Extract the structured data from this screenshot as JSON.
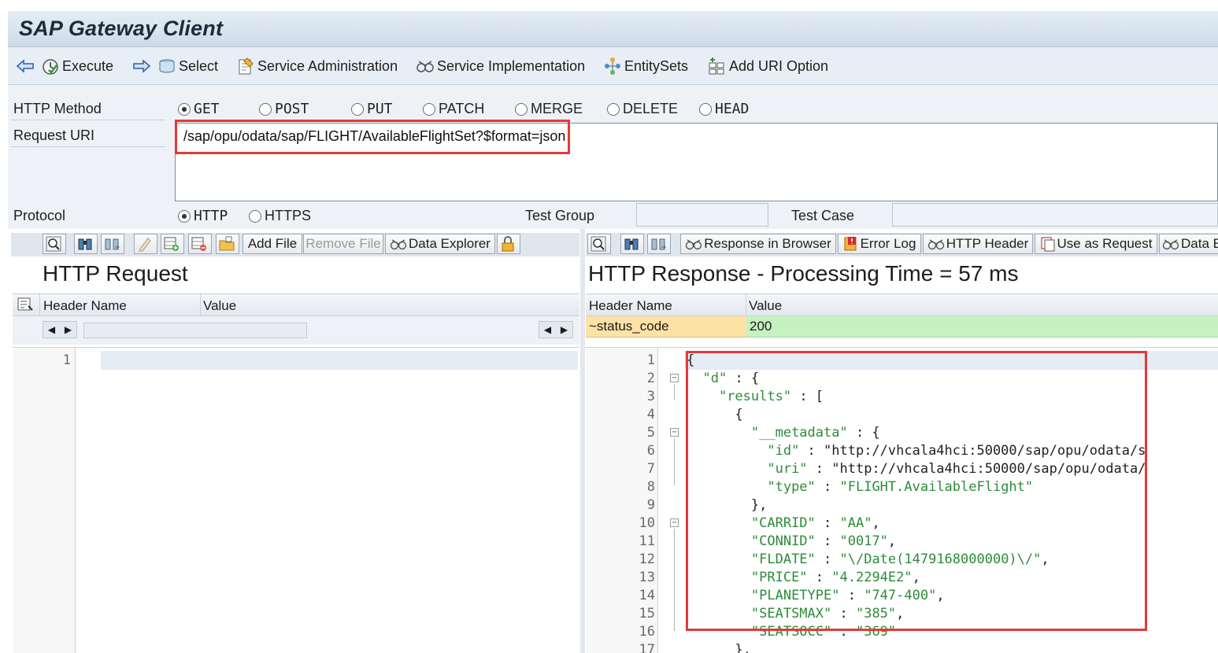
{
  "window": {
    "title": "SAP Gateway Client"
  },
  "toolbar": {
    "execute": "Execute",
    "select": "Select",
    "service_admin": "Service Administration",
    "service_impl": "Service Implementation",
    "entity_sets": "EntitySets",
    "add_uri_option": "Add URI Option"
  },
  "form": {
    "http_method_label": "HTTP Method",
    "methods": [
      "GET",
      "POST",
      "PUT",
      "PATCH",
      "MERGE",
      "DELETE",
      "HEAD"
    ],
    "selected_method": "GET",
    "request_uri_label": "Request URI",
    "request_uri": "/sap/opu/odata/sap/FLIGHT/AvailableFlightSet?$format=json",
    "protocol_label": "Protocol",
    "protocols": [
      "HTTP",
      "HTTPS"
    ],
    "selected_protocol": "HTTP",
    "test_group_label": "Test Group",
    "test_group_value": "",
    "test_case_label": "Test Case",
    "test_case_value": ""
  },
  "request_panel": {
    "add_file": "Add File",
    "remove_file": "Remove File",
    "data_explorer": "Data Explorer",
    "title": "HTTP Request",
    "col_header_name": "Header Name",
    "col_value": "Value",
    "body_line_numbers": [
      "1"
    ]
  },
  "response_panel": {
    "response_in_browser": "Response in Browser",
    "error_log": "Error Log",
    "http_header": "HTTP Header",
    "use_as_request": "Use as Request",
    "data_explorer": "Data E",
    "title": "HTTP Response - Processing Time = 57  ms",
    "col_header_name": "Header Name",
    "col_value": "Value",
    "status_row": {
      "name": "~status_code",
      "value": "200"
    },
    "body_lines": [
      {
        "n": "1",
        "text": "{"
      },
      {
        "n": "2",
        "text": "  \"d\" : {"
      },
      {
        "n": "3",
        "text": "    \"results\" : ["
      },
      {
        "n": "4",
        "text": "      {"
      },
      {
        "n": "5",
        "text": "        \"__metadata\" : {"
      },
      {
        "n": "6",
        "text": "          \"id\" : \"http://vhcala4hci:50000/sap/opu/odata/s"
      },
      {
        "n": "7",
        "text": "          \"uri\" : \"http://vhcala4hci:50000/sap/opu/odata/"
      },
      {
        "n": "8",
        "text": "          \"type\" : \"FLIGHT.AvailableFlight\""
      },
      {
        "n": "9",
        "text": "        },"
      },
      {
        "n": "10",
        "text": "        \"CARRID\" : \"AA\","
      },
      {
        "n": "11",
        "text": "        \"CONNID\" : \"0017\","
      },
      {
        "n": "12",
        "text": "        \"FLDATE\" : \"\\/Date(1479168000000)\\/\","
      },
      {
        "n": "13",
        "text": "        \"PRICE\" : \"4.2294E2\","
      },
      {
        "n": "14",
        "text": "        \"PLANETYPE\" : \"747-400\","
      },
      {
        "n": "15",
        "text": "        \"SEATSMAX\" : \"385\","
      },
      {
        "n": "16",
        "text": "        \"SEATSOCC\" : \"369\""
      },
      {
        "n": "17",
        "text": "      },"
      }
    ]
  },
  "colors": {
    "highlight_red": "#e53935",
    "status_name_bg": "#fde2a6",
    "status_value_bg": "#c6f2c2",
    "json_string": "#2e8b3a"
  }
}
